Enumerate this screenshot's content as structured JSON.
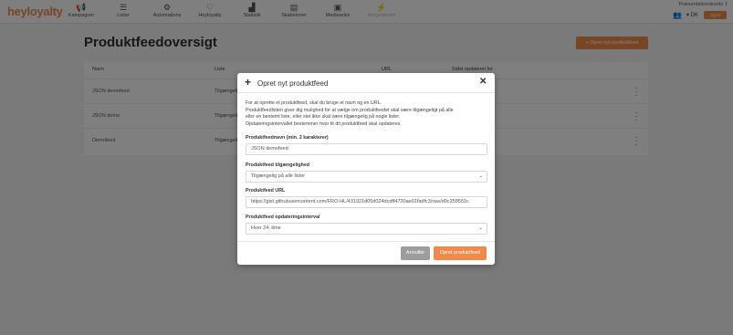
{
  "app": {
    "logo": "heyloyalty",
    "account_name": "Præsentationskonto 1",
    "lang": "▾ DK",
    "top_button": "Opret"
  },
  "nav": [
    {
      "label": "Kampagner",
      "icon": "megaphone-icon",
      "glyph": "📢"
    },
    {
      "label": "Lister",
      "icon": "list-icon",
      "glyph": "☰"
    },
    {
      "label": "Automations",
      "icon": "automation-icon",
      "glyph": "⚙"
    },
    {
      "label": "Heyloyalty",
      "icon": "heyloyalty-icon",
      "glyph": "♡"
    },
    {
      "label": "Statistik",
      "icon": "chart-icon",
      "glyph": "▟"
    },
    {
      "label": "Skabeloner",
      "icon": "template-icon",
      "glyph": "▤"
    },
    {
      "label": "Mediearkiv",
      "icon": "media-icon",
      "glyph": "▣"
    },
    {
      "label": "Integrationer",
      "icon": "plug-icon",
      "glyph": "⚡",
      "disabled": true
    }
  ],
  "page": {
    "title": "Produktfeedoversigt",
    "create_button": "Opret nyt produktfeed",
    "table": {
      "headers": [
        "Navn",
        "Liste",
        "URL",
        "Sidst opdateret for"
      ],
      "rows": [
        {
          "name": "JSON demofeed",
          "list": "Tilgængelig"
        },
        {
          "name": "JSON demo",
          "list": "Tilgængelig"
        },
        {
          "name": "Demofeed",
          "list": "Tilgængelig"
        }
      ]
    }
  },
  "modal": {
    "title": "Opret nyt produktfeed",
    "intro": [
      "For at oprette et produktfeed, skal du bruge et navn og en URL.",
      "Produktfeedlisten giver dig mulighed for at vælge om produktfeedet skal være tilgængeligt på alle",
      "eller en bestemt liste, eller slet ikke skal være tilgængelig på nogle lister.",
      "Opdateringsintervallet bestemmer hvor tit dit produktfeed skal opdateres."
    ],
    "name_label": "Produktfeednavn (min. 2 karakterer)",
    "name_value": "JSON demofeed",
    "availability_label": "Produktfeed tilgængelighed",
    "availability_value": "Tilgængelig på alle lister",
    "url_label": "Produktfeed URL",
    "url_value": "https://gist.githubusercontent.com/FRO-HL/431921d05d024dcdff4720ae01fadfc3/raw/d9c258551c",
    "interval_label": "Produktfeed opdateringsinterval",
    "interval_value": "Hver 24. time",
    "cancel_label": "Annullér",
    "submit_label": "Opret produktfeed"
  }
}
